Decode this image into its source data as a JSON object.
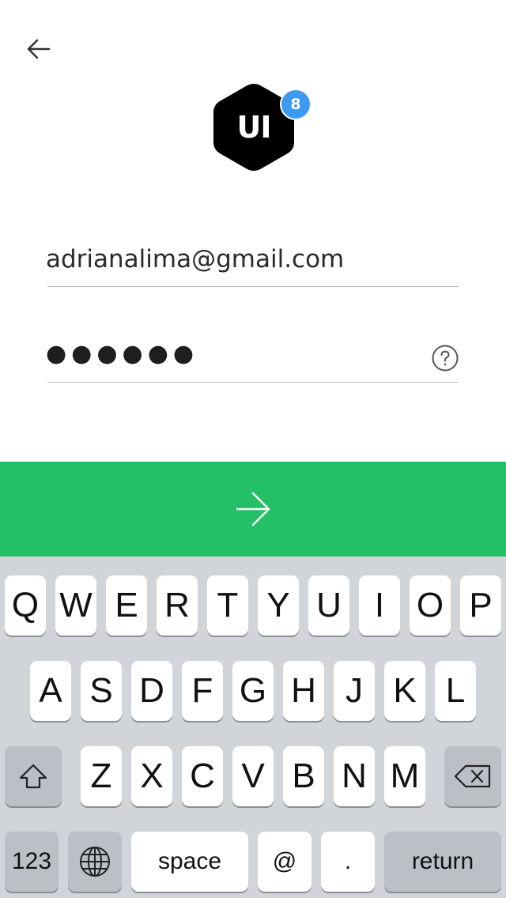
{
  "logo": {
    "text": "UI",
    "badge": "8",
    "badge_color": "#3d9af0"
  },
  "form": {
    "email_value": "adrianalima@gmail.com",
    "password_masked": "●●●●●●"
  },
  "icons": {
    "back": "arrow-left-icon",
    "help": "question-circle-icon",
    "submit": "arrow-right-icon",
    "shift": "shift-icon",
    "delete": "backspace-icon",
    "globe": "globe-icon"
  },
  "colors": {
    "accent_green": "#23c066",
    "keyboard_bg": "#d1d4d9"
  },
  "keyboard": {
    "row1": [
      "Q",
      "W",
      "E",
      "R",
      "T",
      "Y",
      "U",
      "I",
      "O",
      "P"
    ],
    "row2": [
      "A",
      "S",
      "D",
      "F",
      "G",
      "H",
      "J",
      "K",
      "L"
    ],
    "row3": [
      "Z",
      "X",
      "C",
      "V",
      "B",
      "N",
      "M"
    ],
    "numbers_label": "123",
    "space_label": "space",
    "at_label": "@",
    "dot_label": ".",
    "return_label": "return"
  }
}
